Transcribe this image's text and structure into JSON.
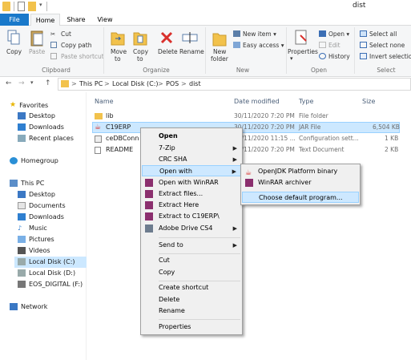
{
  "window": {
    "title": "dist"
  },
  "tabs": [
    "File",
    "Home",
    "Share",
    "View"
  ],
  "ribbon": {
    "clipboard": {
      "copy": "Copy",
      "paste": "Paste",
      "cut": "Cut",
      "copy_path": "Copy path",
      "paste_shortcut": "Paste shortcut",
      "group": "Clipboard"
    },
    "organize": {
      "move_to_1": "Move",
      "move_to_2": "to",
      "copy_to_1": "Copy",
      "copy_to_2": "to",
      "delete": "Delete",
      "rename": "Rename",
      "group": "Organize"
    },
    "new": {
      "new_folder_1": "New",
      "new_folder_2": "folder",
      "new_item": "New item",
      "easy_access": "Easy access",
      "group": "New"
    },
    "open": {
      "properties": "Properties",
      "open": "Open",
      "edit": "Edit",
      "history": "History",
      "group": "Open"
    },
    "select": {
      "select_all": "Select all",
      "select_none": "Select none",
      "invert": "Invert selection",
      "group": "Select"
    }
  },
  "address": {
    "crumbs": [
      "This PC",
      "Local Disk (C:)",
      "POS",
      "dist"
    ],
    "sep": ">"
  },
  "nav": {
    "quick_access": "Favorites",
    "favorites": [
      "Desktop",
      "Downloads",
      "Recent places"
    ],
    "homegroup": "Homegroup",
    "this_pc": "This PC",
    "pc_items": [
      "Desktop",
      "Documents",
      "Downloads",
      "Music",
      "Pictures",
      "Videos",
      "Local Disk (C:)",
      "Local Disk (D:)",
      "EOS_DIGITAL (F:)"
    ],
    "network": "Network"
  },
  "columns": {
    "name": "Name",
    "date": "Date modified",
    "type": "Type",
    "size": "Size"
  },
  "files": [
    {
      "name": "lib",
      "date": "30/11/2020 7:20 PM",
      "type": "File folder",
      "size": ""
    },
    {
      "name": "C19ERP",
      "date": "30/11/2020 7:20 PM",
      "type": "JAR File",
      "size": "6,504 KB"
    },
    {
      "name": "ceDBConn",
      "date": "30/11/2020 11:15 ...",
      "type": "Configuration sett...",
      "size": "1 KB"
    },
    {
      "name": "README",
      "date": "30/11/2020 7:20 PM",
      "type": "Text Document",
      "size": "2 KB"
    }
  ],
  "context_menu": {
    "items": [
      "Open",
      "7-Zip",
      "CRC SHA",
      "Open with",
      "Open with WinRAR",
      "Extract files...",
      "Extract Here",
      "Extract to C19ERP\\",
      "Adobe Drive CS4",
      "Send to",
      "Cut",
      "Copy",
      "Create shortcut",
      "Delete",
      "Rename",
      "Properties"
    ]
  },
  "submenu": {
    "items": [
      "OpenJDK Platform binary",
      "WinRAR archiver",
      "Choose default program..."
    ]
  },
  "colors": {
    "accent": "#1979ca",
    "selection": "#cce8ff",
    "folder": "#f2c24c"
  }
}
